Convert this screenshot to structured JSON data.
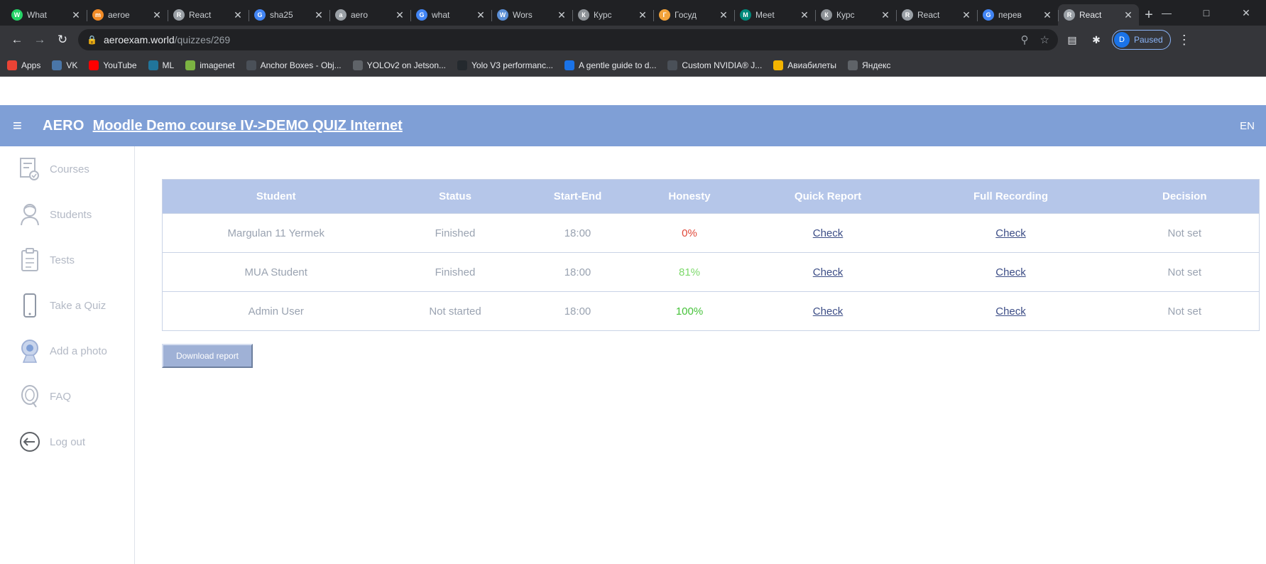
{
  "browser": {
    "tabs": [
      {
        "label": "What",
        "icon": "whatsapp-icon",
        "color": "#25d366",
        "glyph": "W"
      },
      {
        "label": "aeroe",
        "icon": "aero-logo-icon",
        "color": "#f28b26",
        "glyph": "m"
      },
      {
        "label": "React",
        "icon": "chrome-page-icon",
        "color": "#9aa0a6",
        "glyph": "R"
      },
      {
        "label": "sha25",
        "icon": "google-icon",
        "color": "#4285f4",
        "glyph": "G"
      },
      {
        "label": "aero",
        "icon": "chrome-page-icon",
        "color": "#9aa0a6",
        "glyph": "a"
      },
      {
        "label": "what",
        "icon": "google-icon",
        "color": "#4285f4",
        "glyph": "G"
      },
      {
        "label": "Wors",
        "icon": "shield-icon",
        "color": "#5b8fd6",
        "glyph": "W"
      },
      {
        "label": "Курс",
        "icon": "document-icon",
        "color": "#8d9297",
        "glyph": "К"
      },
      {
        "label": "Госуд",
        "icon": "gosuslugi-icon",
        "color": "#f3a33a",
        "glyph": "Г"
      },
      {
        "label": "Meet",
        "icon": "meet-icon",
        "color": "#00897b",
        "glyph": "M"
      },
      {
        "label": "Курс",
        "icon": "document-icon",
        "color": "#8d9297",
        "glyph": "К"
      },
      {
        "label": "React",
        "icon": "chrome-page-icon",
        "color": "#9aa0a6",
        "glyph": "R"
      },
      {
        "label": "перев",
        "icon": "google-icon",
        "color": "#4285f4",
        "glyph": "G"
      },
      {
        "label": "React",
        "icon": "chrome-page-icon",
        "color": "#9aa0a6",
        "glyph": "R",
        "active": true
      }
    ],
    "url_host": "aeroexam.world",
    "url_path": "/quizzes/269",
    "profile_initial": "D",
    "profile_status": "Paused",
    "bookmarks": [
      {
        "label": "Apps",
        "icon": "apps-grid-icon",
        "color": "#ea4335"
      },
      {
        "label": "VK",
        "icon": "vk-icon",
        "color": "#4a76a8"
      },
      {
        "label": "YouTube",
        "icon": "youtube-icon",
        "color": "#ff0000"
      },
      {
        "label": "ML",
        "icon": "wordpress-icon",
        "color": "#21759b"
      },
      {
        "label": "imagenet",
        "icon": "imagenet-icon",
        "color": "#7cb342"
      },
      {
        "label": "Anchor Boxes - Obj...",
        "icon": "infinity-icon",
        "color": "#4a5058"
      },
      {
        "label": "YOLOv2 on Jetson...",
        "icon": "chrome-page-icon",
        "color": "#5f6368"
      },
      {
        "label": "Yolo V3 performanc...",
        "icon": "github-icon",
        "color": "#24292e"
      },
      {
        "label": "A gentle guide to d...",
        "icon": "p-icon",
        "color": "#1a73e8"
      },
      {
        "label": "Custom NVIDIA® J...",
        "icon": "cc-icon",
        "color": "#4a5058"
      },
      {
        "label": "Авиабилеты",
        "icon": "plane-icon",
        "color": "#f4b400"
      },
      {
        "label": "Яндекс",
        "icon": "chrome-page-icon",
        "color": "#5f6368"
      }
    ]
  },
  "header": {
    "brand": "AERO",
    "crumb_course": "Moodle Demo course IV->",
    "crumb_quiz": "DEMO QUIZ Internet",
    "language": "EN"
  },
  "sidebar": {
    "items": [
      {
        "label": "Courses",
        "icon": "courses-icon"
      },
      {
        "label": "Students",
        "icon": "students-icon"
      },
      {
        "label": "Tests",
        "icon": "tests-clipboard-icon"
      },
      {
        "label": "Take a Quiz",
        "icon": "phone-icon"
      },
      {
        "label": "Add a photo",
        "icon": "webcam-icon"
      },
      {
        "label": "FAQ",
        "icon": "faq-icon"
      },
      {
        "label": "Log out",
        "icon": "logout-icon"
      }
    ]
  },
  "table": {
    "columns": [
      "Student",
      "Status",
      "Start-End",
      "Honesty",
      "Quick Report",
      "Full Recording",
      "Decision"
    ],
    "rows": [
      {
        "student": "Margulan 11 Yermek",
        "status": "Finished",
        "start_end": "18:00",
        "honesty": "0%",
        "quick_report": "Check",
        "full_recording": "Check",
        "decision": "Not set"
      },
      {
        "student": "MUA Student",
        "status": "Finished",
        "start_end": "18:00",
        "honesty": "81%",
        "quick_report": "Check",
        "full_recording": "Check",
        "decision": "Not set"
      },
      {
        "student": "Admin User",
        "status": "Not started",
        "start_end": "18:00",
        "honesty": "100%",
        "quick_report": "Check",
        "full_recording": "Check",
        "decision": "Not set"
      }
    ]
  },
  "actions": {
    "download_report": "Download report"
  },
  "colors": {
    "header_bg": "#7f9fd6",
    "table_header_bg": "#b5c6e9",
    "honesty_low": "#e0483a",
    "honesty_mid": "#7dd96b",
    "honesty_high": "#46c23a",
    "link": "#3c4d86"
  }
}
